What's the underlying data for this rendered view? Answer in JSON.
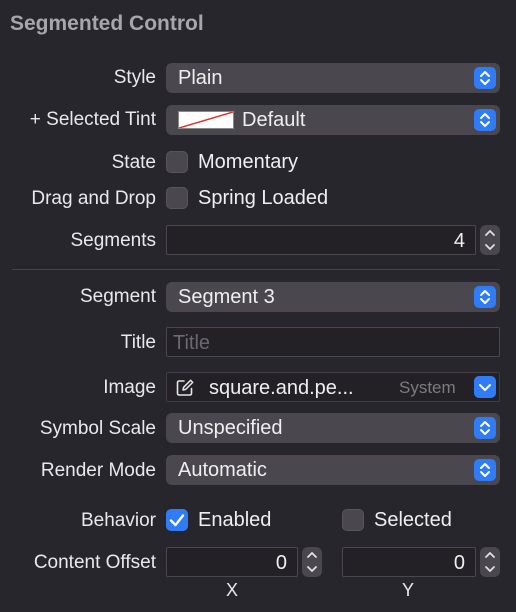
{
  "section": {
    "title": "Segmented Control"
  },
  "style": {
    "label": "Style",
    "value": "Plain"
  },
  "selected_tint": {
    "plus": "+",
    "label": "Selected Tint",
    "value": "Default"
  },
  "state": {
    "label": "State",
    "checkbox_label": "Momentary"
  },
  "drag_drop": {
    "label": "Drag and Drop",
    "checkbox_label": "Spring Loaded"
  },
  "segments": {
    "label": "Segments",
    "value": "4"
  },
  "segment": {
    "label": "Segment",
    "value": "Segment 3"
  },
  "title_field": {
    "label": "Title",
    "placeholder": "Title"
  },
  "image": {
    "label": "Image",
    "value": "square.and.pe...",
    "source": "System"
  },
  "symbol_scale": {
    "label": "Symbol Scale",
    "value": "Unspecified"
  },
  "render_mode": {
    "label": "Render Mode",
    "value": "Automatic"
  },
  "behavior": {
    "label": "Behavior",
    "enabled_label": "Enabled",
    "selected_label": "Selected"
  },
  "content_offset": {
    "label": "Content Offset",
    "x_value": "0",
    "y_value": "0",
    "x_axis": "X",
    "y_axis": "Y"
  },
  "colors": {
    "accent": "#2f7cf6",
    "panel": "#28262d",
    "control": "#4a484e"
  }
}
